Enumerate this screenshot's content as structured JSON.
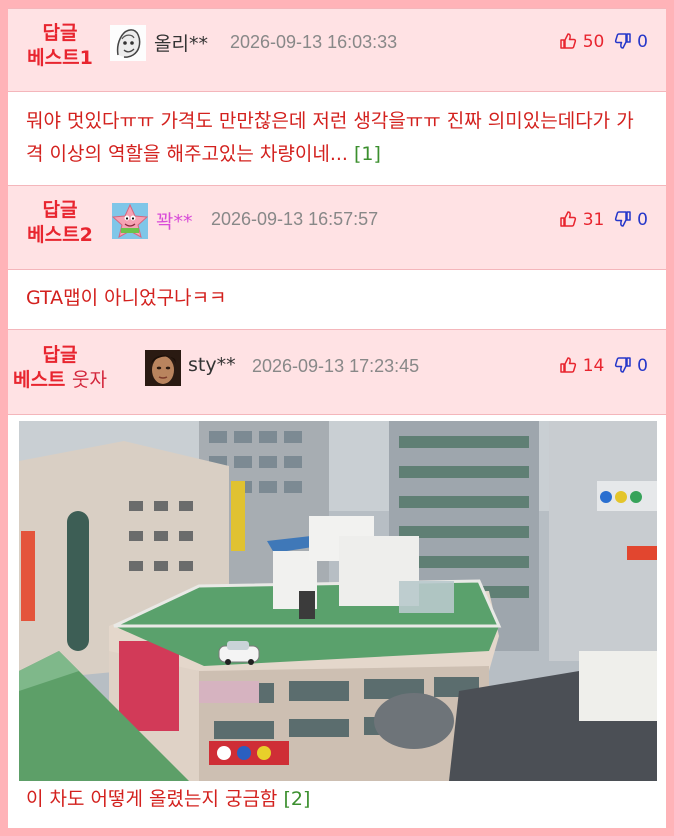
{
  "comments": [
    {
      "tag_line1": "답글",
      "tag_line2": "베스트1",
      "tag_extra": "",
      "nick": "올리**",
      "date": "2026-09-13 16:03:33",
      "likes": "50",
      "dislikes": "0",
      "avatar": "ghost-sketch-avatar",
      "text": "뭐야 멋있다ㅠㅠ 가격도 만만찮은데 저런 생각을ㅠㅠ 진짜 의미있는데다가 가격 이상의 역할을 해주고있는 차량이네...",
      "ref": "[1]"
    },
    {
      "tag_line1": "답글",
      "tag_line2": "베스트2",
      "tag_extra": "",
      "nick": "꽉**",
      "date": "2026-09-13 16:57:57",
      "likes": "31",
      "dislikes": "0",
      "avatar": "starfish-avatar",
      "text": "GTA맵이 아니었구나ㅋㅋ",
      "ref": ""
    },
    {
      "tag_line1": "답글",
      "tag_line2": "베스트",
      "tag_extra": "웃자",
      "nick": "sty**",
      "date": "2026-09-13 17:23:45",
      "likes": "14",
      "dislikes": "0",
      "avatar": "face-avatar",
      "text": "이 차도 어떻게 올렸는지 궁금함",
      "ref": "[2]"
    }
  ],
  "colors": {
    "accent_red": "#e8252f",
    "header_bg": "#ffe2e4",
    "frame": "#ffb3b8",
    "dislike_blue": "#2637c9",
    "ref_green": "#3b8f2e",
    "nick_pink": "#d84bd8"
  },
  "icons": [
    "thumbs-up-icon",
    "thumbs-down-icon"
  ]
}
